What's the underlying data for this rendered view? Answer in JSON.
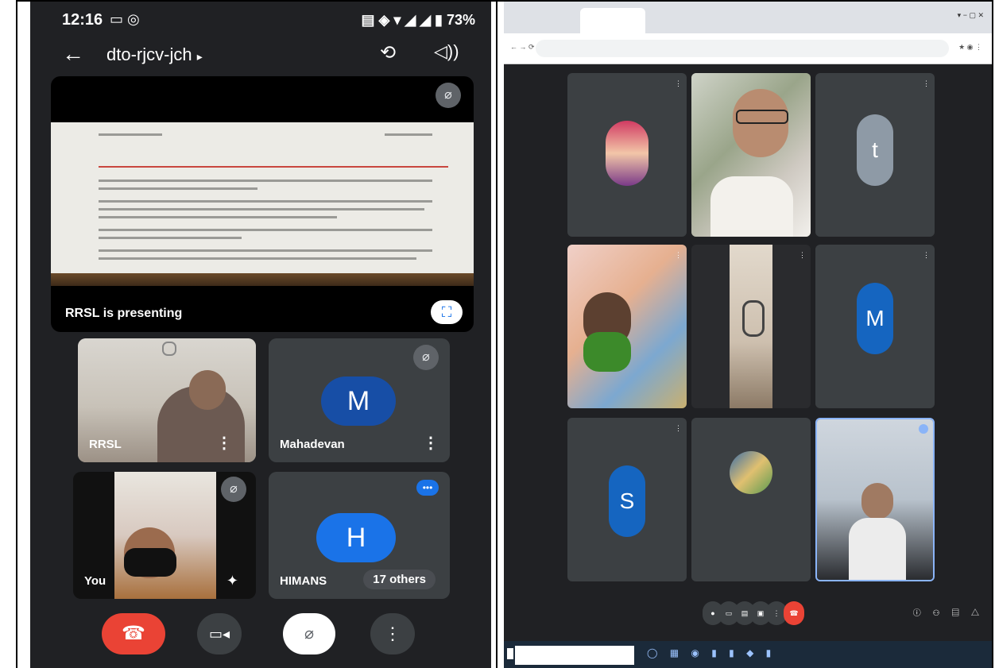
{
  "phone": {
    "status": {
      "time": "12:16",
      "battery": "73%"
    },
    "meeting_code": "dto-rjcv-jch",
    "presentation": {
      "label": "RRSL is presenting"
    },
    "tiles": [
      {
        "name": "RRSL"
      },
      {
        "name": "Mahadevan",
        "initial": "M",
        "color": "#174ea6"
      },
      {
        "name": "You"
      },
      {
        "name": "HIMANS",
        "initial": "H",
        "color": "#1a73e8",
        "others": "17 others"
      }
    ],
    "controls": {
      "end_call_color": "#ea4335"
    }
  },
  "desktop": {
    "tiles": [
      {
        "initial": "t",
        "color": "#8e9aa6"
      },
      {
        "initial": "M",
        "color": "#1565c0"
      },
      {
        "initial": "S",
        "color": "#1565c0"
      }
    ],
    "leave_color": "#ea4335"
  }
}
